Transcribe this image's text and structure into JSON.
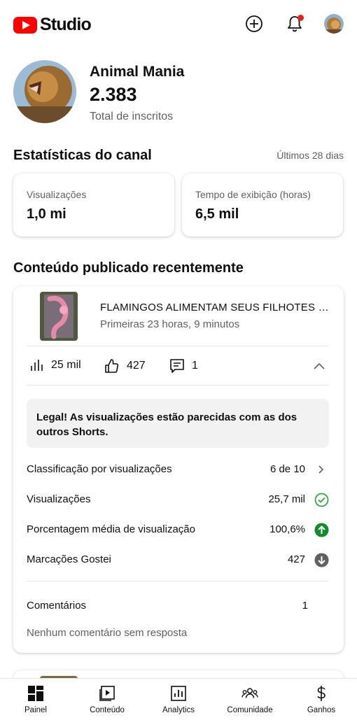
{
  "app": {
    "logo_text": "Studio",
    "brand_color": "#ff0000"
  },
  "header": {
    "icons": [
      "add-circle-icon",
      "bell-icon",
      "account-avatar"
    ],
    "notification_color": "#e62117"
  },
  "channel": {
    "name": "Animal Mania",
    "subscribers": "2.383",
    "subscribers_label": "Total de inscritos"
  },
  "stats": {
    "title": "Estatísticas do canal",
    "period": "Últimos 28 dias",
    "cards": [
      {
        "label": "Visualizações",
        "value": "1,0 mi"
      },
      {
        "label": "Tempo de exibição (horas)",
        "value": "6,5 mil"
      }
    ]
  },
  "recent": {
    "title": "Conteúdo publicado recentemente",
    "video": {
      "title": "FLAMINGOS ALIMENTAM SEUS FILHOTES COM LEITE",
      "subtitle": "Primeiras 23 horas, 9 minutos",
      "views": "25 mil",
      "likes": "427",
      "comments": "1"
    },
    "banner": "Legal! As visualizações estão parecidas com as dos outros Shorts.",
    "rows": [
      {
        "label": "Classificação por visualizações",
        "value": "6 de 10",
        "icon": "chevron-right-icon"
      },
      {
        "label": "Visualizações",
        "value": "25,7 mil",
        "icon": "check-circle-icon"
      },
      {
        "label": "Porcentagem média de visualização",
        "value": "100,6%",
        "icon": "arrow-up-circle-icon"
      },
      {
        "label": "Marcações Gostei",
        "value": "427",
        "icon": "arrow-down-circle-icon"
      }
    ],
    "comments_label": "Comentários",
    "comments_count": "1",
    "comments_note": "Nenhum comentário sem resposta",
    "status_colors": {
      "good": "#2ba640",
      "neutral": "#606060"
    }
  },
  "nav": {
    "items": [
      {
        "label": "Painel",
        "icon": "dashboard-icon"
      },
      {
        "label": "Conteúdo",
        "icon": "content-icon"
      },
      {
        "label": "Analytics",
        "icon": "analytics-icon"
      },
      {
        "label": "Comunidade",
        "icon": "community-icon"
      },
      {
        "label": "Ganhos",
        "icon": "earn-icon"
      }
    ]
  }
}
